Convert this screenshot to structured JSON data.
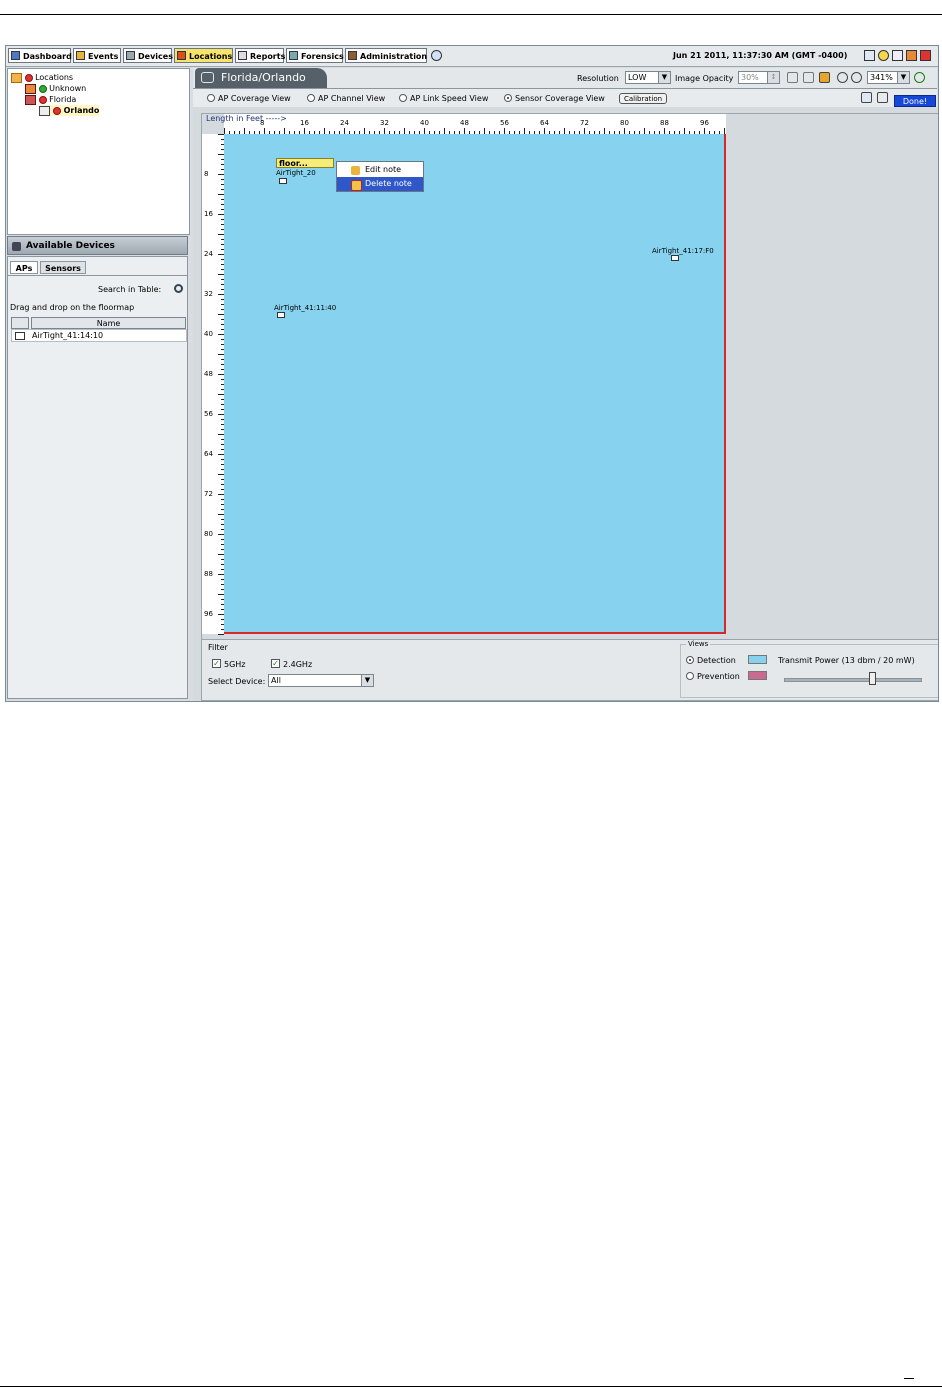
{
  "nav": {
    "items": [
      {
        "label": "Dashboard"
      },
      {
        "label": "Events"
      },
      {
        "label": "Devices"
      },
      {
        "label": "Locations"
      },
      {
        "label": "Reports"
      },
      {
        "label": "Forensics"
      },
      {
        "label": "Administration"
      }
    ],
    "active": "Locations",
    "datetime": "Jun 21 2011, 11:37:30 AM (GMT -0400)"
  },
  "tree": {
    "items": [
      {
        "label": "Locations"
      },
      {
        "label": "Unknown"
      },
      {
        "label": "Florida"
      },
      {
        "label": "Orlando"
      }
    ]
  },
  "devices_panel": {
    "title": "Available Devices",
    "tabs": [
      {
        "label": "APs"
      },
      {
        "label": "Sensors"
      }
    ],
    "search_label": "Search in Table:",
    "hint": "Drag and drop on the floormap",
    "table": {
      "columns": [
        "",
        "Name"
      ],
      "rows": [
        {
          "name": "AirTight_41:14:10"
        }
      ]
    }
  },
  "floor": {
    "title": "Florida/Orlando",
    "resolution_label": "Resolution",
    "resolution_value": "LOW",
    "opacity_label": "Image Opacity",
    "opacity_value": "30%",
    "zoom_value": "341%",
    "views": [
      {
        "label": "AP Coverage View",
        "selected": false
      },
      {
        "label": "AP Channel View",
        "selected": false
      },
      {
        "label": "AP Link Speed View",
        "selected": false
      },
      {
        "label": "Sensor Coverage View",
        "selected": true
      }
    ],
    "calibration_label": "Calibration",
    "done_label": "Done!",
    "ruler_label": "Length in  Feet ----->",
    "x_ticks": [
      "8",
      "16",
      "24",
      "32",
      "40",
      "48",
      "56",
      "64",
      "72",
      "80",
      "88",
      "96"
    ],
    "y_ticks": [
      "8",
      "16",
      "24",
      "32",
      "40",
      "48",
      "56",
      "64",
      "72",
      "80",
      "88",
      "96"
    ],
    "devices": [
      {
        "label": "AirTight_20"
      },
      {
        "label": "AirTight_41:17:F0"
      },
      {
        "label": "AirTight_41:11:40"
      }
    ],
    "note_label": "floor...",
    "context_menu": [
      {
        "label": "Edit note"
      },
      {
        "label": "Delete note"
      }
    ],
    "floor_color": "#87d3ef"
  },
  "filter": {
    "title": "Filter",
    "band_5": "5GHz",
    "band_24": "2.4GHz",
    "select_label": "Select Device:",
    "select_value": "All"
  },
  "views_panel": {
    "title": "Views",
    "detection_label": "Detection",
    "prevention_label": "Prevention",
    "detection_color": "#87d3ef",
    "prevention_color": "#c86a92",
    "transmit_label": "Transmit Power  (13 dbm /  20 mW)"
  }
}
